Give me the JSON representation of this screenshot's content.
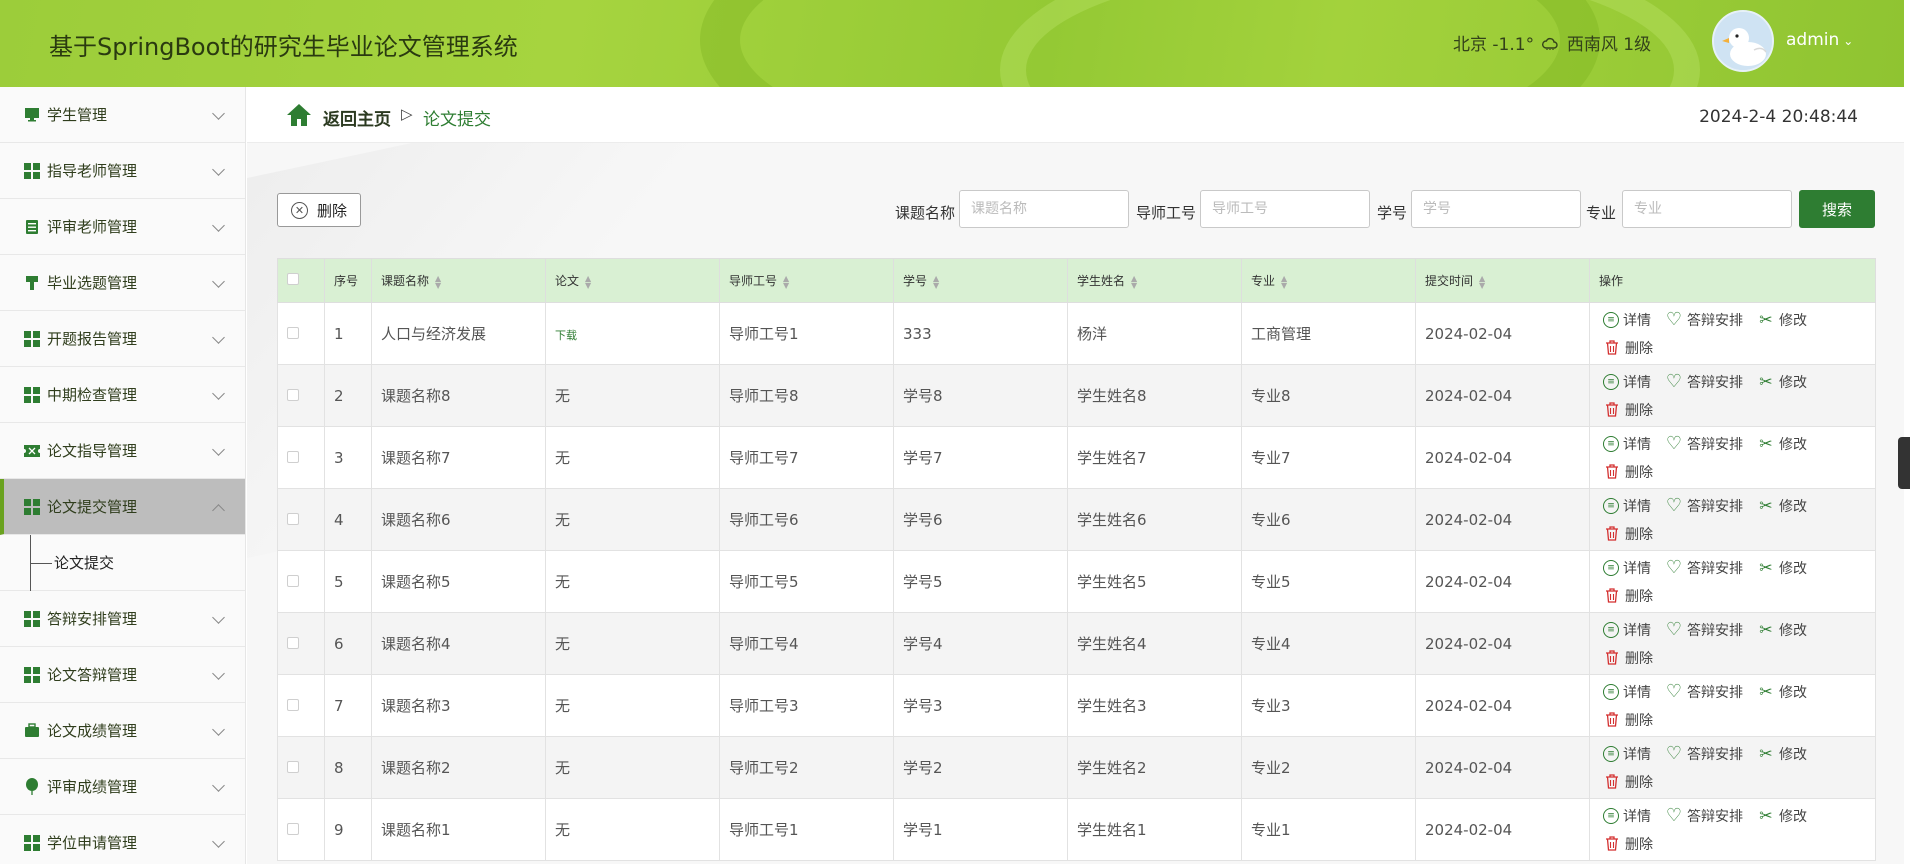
{
  "header": {
    "app_title": "基于SpringBoot的研究生毕业论文管理系统",
    "weather": {
      "city": "北京",
      "temp": "-1.1°",
      "wind": "西南风",
      "level": "1级"
    },
    "user": {
      "name": "admin",
      "chevron": "⌄"
    },
    "colors": {
      "bar": "#9ccd3a",
      "accent": "#2e7d32"
    }
  },
  "sidebar": {
    "items": [
      {
        "label": "学生管理",
        "icon": "monitor-icon"
      },
      {
        "label": "指导老师管理",
        "icon": "grid-icon"
      },
      {
        "label": "评审老师管理",
        "icon": "list-icon"
      },
      {
        "label": "毕业选题管理",
        "icon": "stamp-icon"
      },
      {
        "label": "开题报告管理",
        "icon": "grid-icon"
      },
      {
        "label": "中期检查管理",
        "icon": "grid-icon"
      },
      {
        "label": "论文指导管理",
        "icon": "ticket-icon"
      },
      {
        "label": "论文提交管理",
        "icon": "grid-icon",
        "open": true
      },
      {
        "label": "答辩安排管理",
        "icon": "grid-icon"
      },
      {
        "label": "论文答辩管理",
        "icon": "grid-icon"
      },
      {
        "label": "论文成绩管理",
        "icon": "briefcase-icon"
      },
      {
        "label": "评审成绩管理",
        "icon": "balloon-icon"
      },
      {
        "label": "学位申请管理",
        "icon": "grid-icon"
      }
    ],
    "submenu": {
      "label": "论文提交"
    }
  },
  "breadcrumb": {
    "home": "返回主页",
    "separator": "▷",
    "current": "论文提交"
  },
  "clock": "2024-2-4 20:48:44",
  "toolbar": {
    "delete_label": "删除",
    "filters": [
      {
        "label": "课题名称",
        "placeholder": "课题名称"
      },
      {
        "label": "导师工号",
        "placeholder": "导师工号"
      },
      {
        "label": "学号",
        "placeholder": "学号"
      },
      {
        "label": "专业",
        "placeholder": "专业"
      }
    ],
    "search_label": "搜索"
  },
  "table": {
    "columns": [
      "序号",
      "课题名称",
      "论文",
      "导师工号",
      "学号",
      "学生姓名",
      "专业",
      "提交时间",
      "操作"
    ],
    "ops": {
      "detail": "详情",
      "defense": "答辩安排",
      "edit": "修改",
      "delete": "删除"
    },
    "rows": [
      {
        "index": "1",
        "title": "人口与经济发展",
        "paper": "下载",
        "teacher": "导师工号1",
        "sid": "333",
        "name": "杨洋",
        "major": "工商管理",
        "time": "2024-02-04"
      },
      {
        "index": "2",
        "title": "课题名称8",
        "paper": "无",
        "teacher": "导师工号8",
        "sid": "学号8",
        "name": "学生姓名8",
        "major": "专业8",
        "time": "2024-02-04"
      },
      {
        "index": "3",
        "title": "课题名称7",
        "paper": "无",
        "teacher": "导师工号7",
        "sid": "学号7",
        "name": "学生姓名7",
        "major": "专业7",
        "time": "2024-02-04"
      },
      {
        "index": "4",
        "title": "课题名称6",
        "paper": "无",
        "teacher": "导师工号6",
        "sid": "学号6",
        "name": "学生姓名6",
        "major": "专业6",
        "time": "2024-02-04"
      },
      {
        "index": "5",
        "title": "课题名称5",
        "paper": "无",
        "teacher": "导师工号5",
        "sid": "学号5",
        "name": "学生姓名5",
        "major": "专业5",
        "time": "2024-02-04"
      },
      {
        "index": "6",
        "title": "课题名称4",
        "paper": "无",
        "teacher": "导师工号4",
        "sid": "学号4",
        "name": "学生姓名4",
        "major": "专业4",
        "time": "2024-02-04"
      },
      {
        "index": "7",
        "title": "课题名称3",
        "paper": "无",
        "teacher": "导师工号3",
        "sid": "学号3",
        "name": "学生姓名3",
        "major": "专业3",
        "time": "2024-02-04"
      },
      {
        "index": "8",
        "title": "课题名称2",
        "paper": "无",
        "teacher": "导师工号2",
        "sid": "学号2",
        "name": "学生姓名2",
        "major": "专业2",
        "time": "2024-02-04"
      },
      {
        "index": "9",
        "title": "课题名称1",
        "paper": "无",
        "teacher": "导师工号1",
        "sid": "学号1",
        "name": "学生姓名1",
        "major": "专业1",
        "time": "2024-02-04"
      }
    ]
  }
}
